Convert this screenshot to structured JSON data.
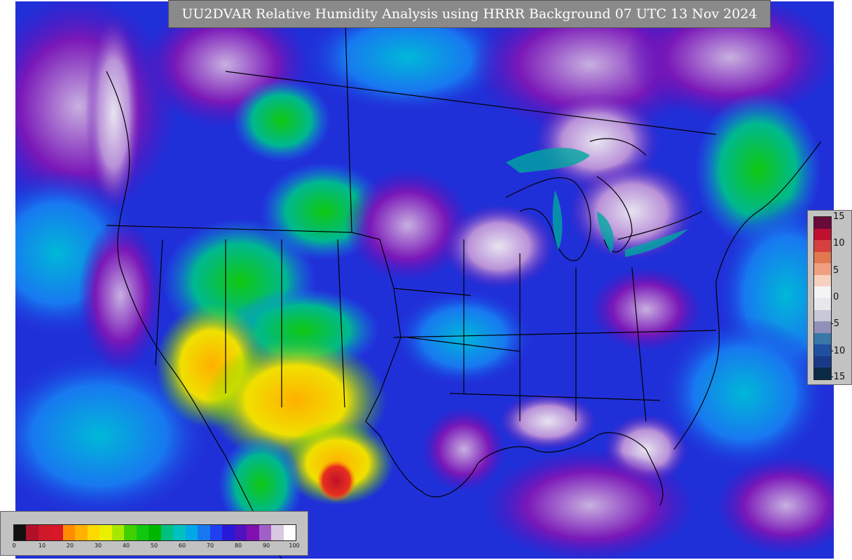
{
  "title": "UU2DVAR Relative Humidity Analysis using HRRR Background 07 UTC 13 Nov 2024",
  "rh_colorbar": {
    "ticks": [
      "0",
      "10",
      "20",
      "30",
      "40",
      "50",
      "60",
      "70",
      "80",
      "90",
      "100"
    ],
    "colors": [
      "#111111",
      "#b0102a",
      "#d01828",
      "#d81828",
      "#ff8c00",
      "#ffb000",
      "#ffd800",
      "#e8f000",
      "#a8e800",
      "#40d000",
      "#10c810",
      "#00b800",
      "#00c080",
      "#00c0c0",
      "#00a8e8",
      "#1878f0",
      "#2040f0",
      "#2818d8",
      "#5010c0",
      "#8010b0",
      "#a060c8",
      "#d8c8e0",
      "#ffffff"
    ]
  },
  "increment_colorbar": {
    "labels": [
      "15",
      "10",
      "5",
      "0",
      "-5",
      "-10",
      "-15"
    ],
    "colors": [
      "#6a0a3a",
      "#c01030",
      "#d84040",
      "#e07850",
      "#f0a080",
      "#f8d0c0",
      "#f4f4f4",
      "#e8e8ec",
      "#c8c8d8",
      "#9090b8",
      "#3878a8",
      "#2050a0",
      "#1a3a88",
      "#0a2a48"
    ]
  }
}
